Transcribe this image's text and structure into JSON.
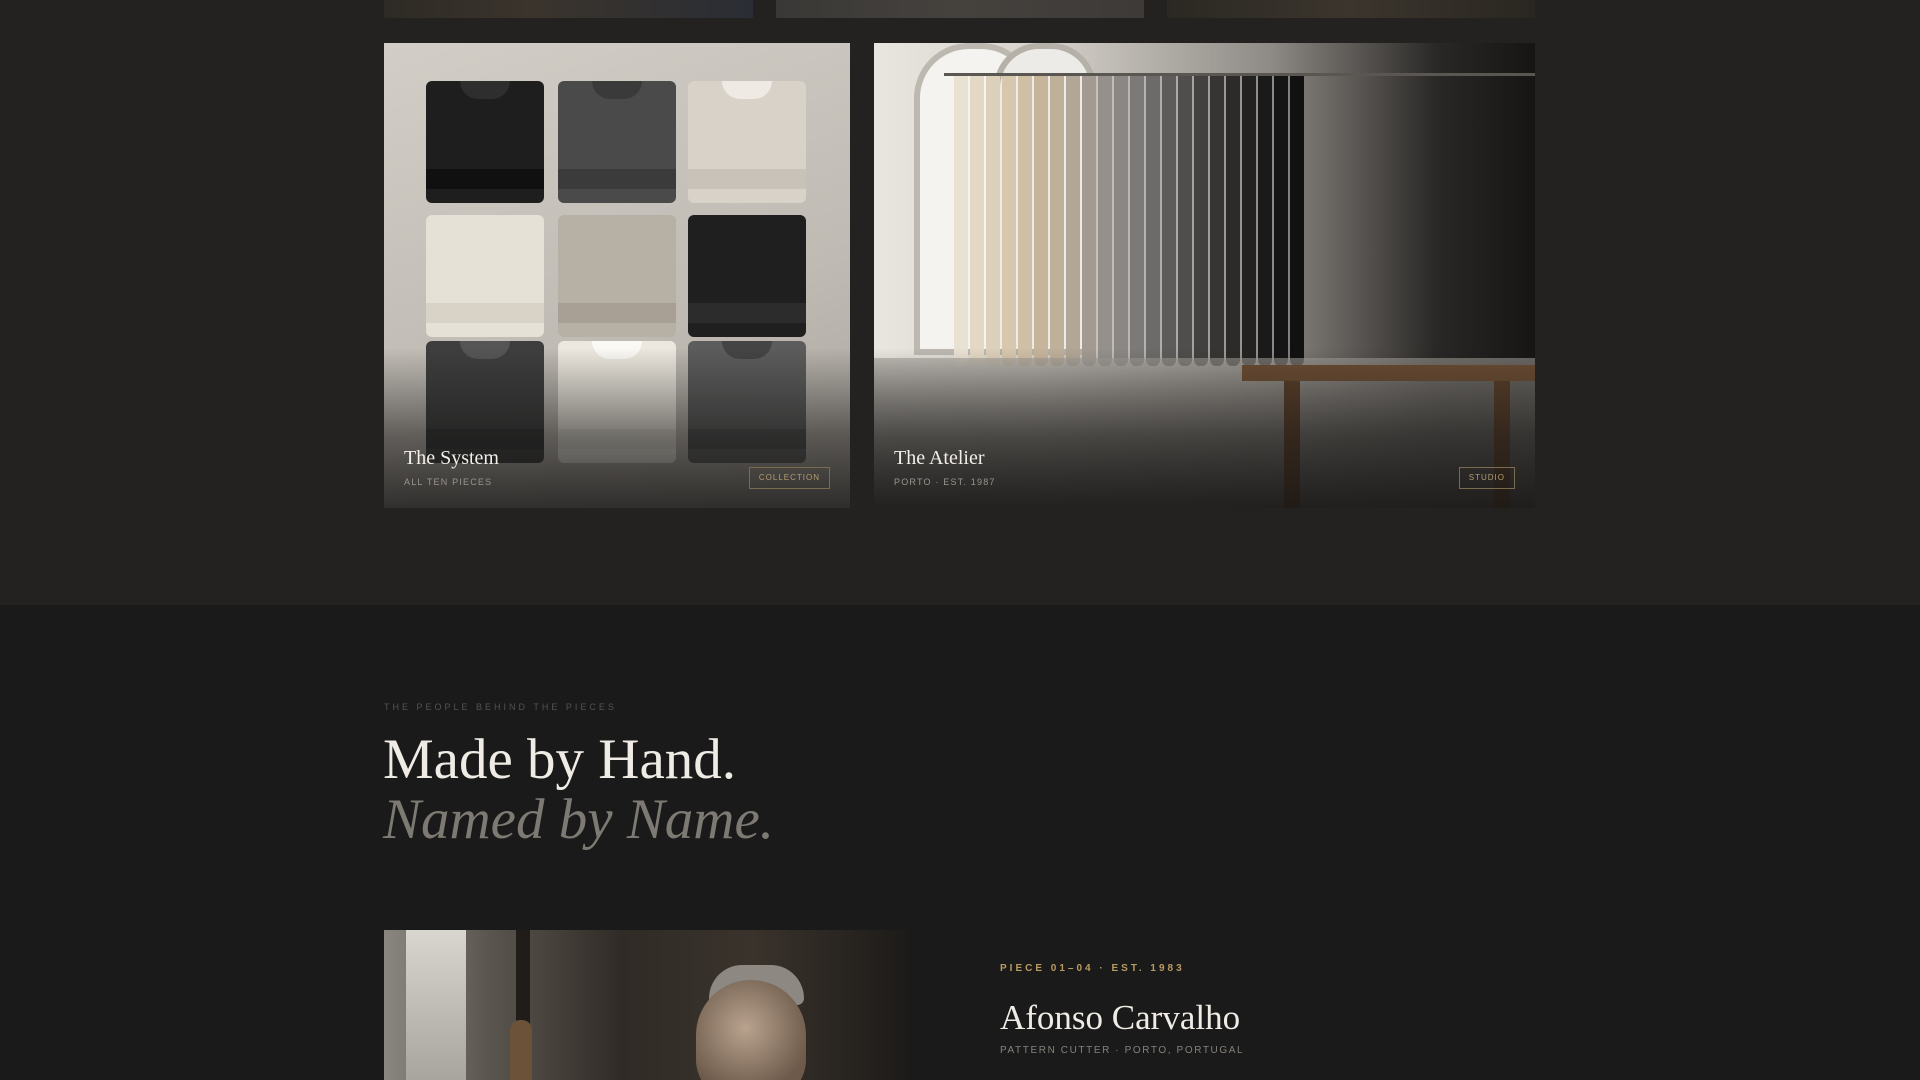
{
  "collection_cards": [
    {
      "title": "The System",
      "subtitle": "ALL TEN PIECES",
      "tag": "COLLECTION"
    },
    {
      "title": "The Atelier",
      "subtitle": "PORTO · EST. 1987",
      "tag": "STUDIO"
    }
  ],
  "people_section": {
    "eyebrow": "THE PEOPLE BEHIND THE PIECES",
    "heading_line1": "Made by Hand.",
    "heading_line2": "Named by Name."
  },
  "featured_maker": {
    "meta": "PIECE 01–04 · EST. 1983",
    "name": "Afonso Carvalho",
    "role": "PATTERN CUTTER · PORTO, PORTUGAL"
  },
  "colors": {
    "accent_gold": "#b89b60",
    "background_dark": "#1b1a19",
    "background_upper": "#242220"
  }
}
